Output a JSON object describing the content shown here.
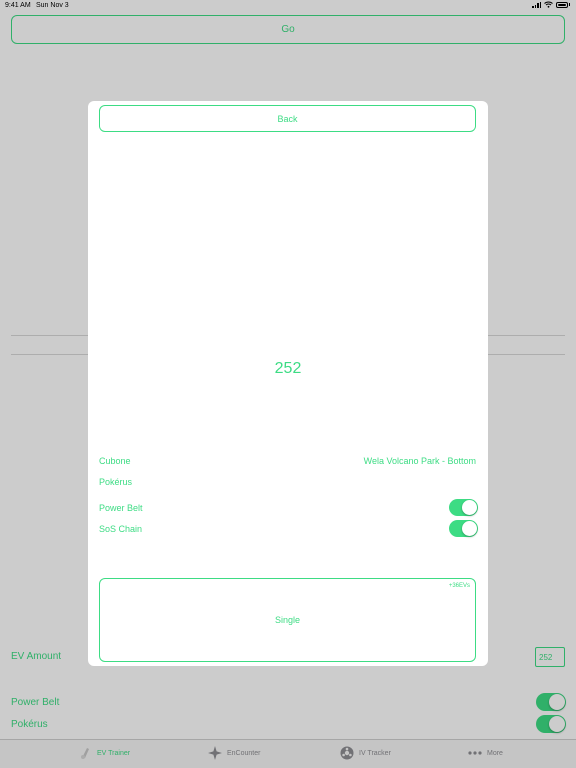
{
  "status_bar": {
    "time": "9:41 AM",
    "date": "Sun Nov 3"
  },
  "background": {
    "go_label": "Go",
    "ev_amount_label": "EV Amount",
    "ev_amount_value": "252",
    "power_belt_label": "Power Belt",
    "power_belt_on": true,
    "pokerus_label": "Pokérus",
    "pokerus_on": true
  },
  "tabs": [
    {
      "label": "EV Trainer",
      "icon": "ev-trainer-icon",
      "active": true
    },
    {
      "label": "EnCounter",
      "icon": "encounter-icon",
      "active": false
    },
    {
      "label": "IV Tracker",
      "icon": "iv-tracker-icon",
      "active": false
    },
    {
      "label": "More",
      "icon": "more-icon",
      "active": false
    }
  ],
  "modal": {
    "back_label": "Back",
    "ev_total": "252",
    "pokemon_name": "Cubone",
    "location": "Wela Volcano Park - Bottom",
    "pokerus_label": "Pokérus",
    "power_belt_label": "Power Belt",
    "power_belt_on": true,
    "sos_chain_label": "SoS Chain",
    "sos_chain_on": true,
    "single_label": "Single",
    "single_badge": "+36EVs"
  },
  "colors": {
    "accent": "#3ddc84",
    "tab_inactive": "#8e8e93",
    "overlay": "rgba(0,0,0,0.2)"
  }
}
